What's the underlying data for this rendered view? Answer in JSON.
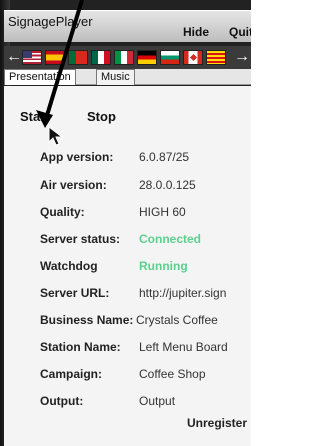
{
  "app": {
    "title": "SignagePlayer"
  },
  "topbar": {
    "hide_label": "Hide",
    "quit_label": "Quit"
  },
  "tabs": [
    {
      "label": "Presentation",
      "active": true
    },
    {
      "label": "Music",
      "active": false
    }
  ],
  "controls": {
    "start_label": "Start",
    "stop_label": "Stop"
  },
  "info": [
    {
      "label": "App version:",
      "value": "6.0.87/25"
    },
    {
      "label": "Air version:",
      "value": "28.0.0.125"
    },
    {
      "label": "Quality:",
      "value": "HIGH 60"
    },
    {
      "label": "Server status:",
      "value": "Connected"
    },
    {
      "label": "Watchdog",
      "value": "Running"
    },
    {
      "label": "Server URL:",
      "value": "http://jupiter.sign"
    },
    {
      "label": "Business Name:",
      "value": "Crystals Coffee"
    },
    {
      "label": "Station Name:",
      "value": "Left Menu Board"
    },
    {
      "label": "Campaign:",
      "value": "Coffee Shop"
    },
    {
      "label": "Output:",
      "value": "Output"
    }
  ],
  "footer": {
    "unregister_label": "Unregister"
  },
  "colors": {
    "status_green": "#5bd08e",
    "annotation_black": "#000000"
  },
  "icons": [
    "arrow-left-icon",
    "arrow-right-icon",
    "mouse-cursor-icon",
    "annotation-arrow-icon"
  ]
}
